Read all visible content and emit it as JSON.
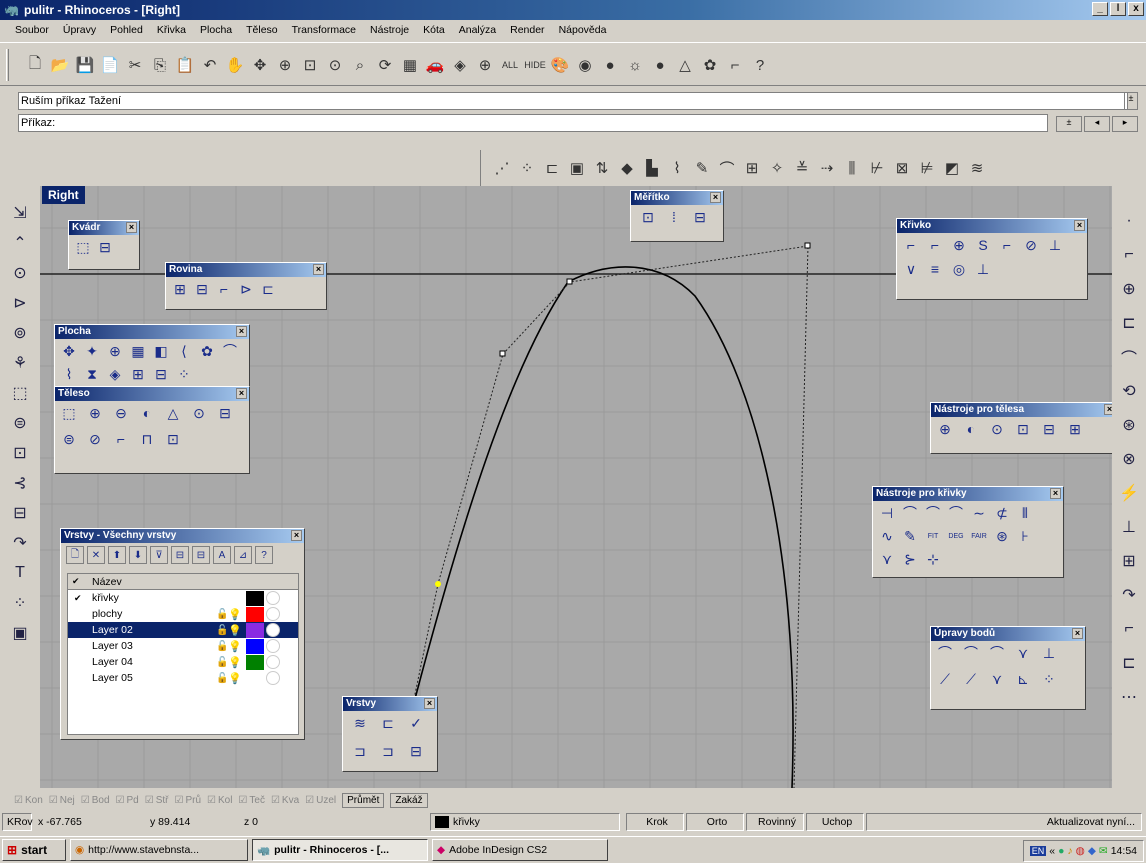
{
  "window": {
    "title": "pulitr - Rhinoceros - [Right]",
    "min": "_",
    "max": "ǀ",
    "close": "x"
  },
  "menu": [
    "Soubor",
    "Úpravy",
    "Pohled",
    "Křivka",
    "Plocha",
    "Těleso",
    "Transformace",
    "Nástroje",
    "Kóta",
    "Analýza",
    "Render",
    "Nápověda"
  ],
  "toolbar1": [
    "🗋",
    "📂",
    "💾",
    "📄",
    "✂",
    "⎘",
    "📋",
    "↶",
    "✋",
    "✥",
    "⊕",
    "⊡",
    "⊙",
    "⌕",
    "⟳",
    "▦",
    "🚗",
    "◈",
    "⊕",
    "ALL",
    "HIDE",
    "🎨",
    "◉",
    "●",
    "☼",
    "●",
    "△",
    "✿",
    "⌐",
    "?"
  ],
  "command": {
    "history": "Ruším příkaz Tažení",
    "prompt": "Příkaz:"
  },
  "toolbar2": [
    "⋰",
    "⁘",
    "⊏",
    "▣",
    "⇅",
    "◆",
    "▙",
    "⌇",
    "✎",
    "⌒",
    "⊞",
    "✧",
    "≚",
    "⇢",
    "⫼",
    "⊬",
    "⊠",
    "⊭",
    "◩",
    "≋"
  ],
  "viewport": {
    "name": "Right",
    "background": "#a9a9a9"
  },
  "left_tools": [
    "⇲",
    "⌃",
    "⊙",
    "⊳",
    "⊚",
    "⚘",
    "⬚",
    "⊜",
    "⊡",
    "⊰",
    "⊟",
    "↷",
    "T",
    "⁘",
    "▣"
  ],
  "right_tools": [
    "·",
    "⌐",
    "⊕",
    "⊏",
    "⌒",
    "⟲",
    "⊛",
    "⊗",
    "⚡",
    "⊥",
    "⊞",
    "↷",
    "⌐",
    "⊏",
    "⋯"
  ],
  "panels": {
    "kvadr": {
      "title": "Kvádr",
      "icons": [
        "⬚",
        "⊟"
      ]
    },
    "rovina": {
      "title": "Rovina",
      "icons": [
        "⊞",
        "⊟",
        "⌐",
        "⊳",
        "⊏"
      ]
    },
    "plocha": {
      "title": "Plocha",
      "icons": [
        "✥",
        "✦",
        "⊕",
        "▦",
        "◧",
        "⟨",
        "✿",
        "⌒",
        "⌇",
        "⧗",
        "◈",
        "⊞",
        "⊟",
        "⁘"
      ]
    },
    "teleso": {
      "title": "Těleso",
      "icons": [
        "⬚",
        "⊕",
        "⊖",
        "◐",
        "△",
        "⊙",
        "⊟",
        "⊜",
        "⊘",
        "⌐",
        "⊓",
        "⊡"
      ]
    },
    "meritko": {
      "title": "Měřítko",
      "icons": [
        "⊡",
        "⁞",
        "⊟"
      ]
    },
    "krivko": {
      "title": "Křivko",
      "icons": [
        "⌐",
        "⌐",
        "⊕",
        "S",
        "⌐",
        "⊘",
        "⊥",
        "∨",
        "≡",
        "◎",
        "⊥"
      ]
    },
    "nastroje_telesa": {
      "title": "Nástroje pro tělesa",
      "icons": [
        "⊕",
        "◐",
        "⊙",
        "⊡",
        "⊟",
        "⊞"
      ]
    },
    "nastroje_krivky": {
      "title": "Nástroje pro křivky",
      "icons": [
        "⊣",
        "⌒",
        "⌒",
        "⌒",
        "∼",
        "⊄",
        "⫴",
        "∿",
        "✎",
        "FIT",
        "DEG",
        "FAIR",
        "⊛",
        "⊦",
        "⋎",
        "⊱",
        "⊹"
      ]
    },
    "upravy_bodu": {
      "title": "Úpravy bodů",
      "icons": [
        "⌒",
        "⌒",
        "⌒",
        "⋎",
        "⊥",
        "⟋",
        "⟋",
        "⋎",
        "⊾",
        "⁘"
      ]
    },
    "vrstvy_small": {
      "title": "Vrstvy",
      "icons": [
        "≋",
        "⊏",
        "✓",
        "⊐",
        "⊐",
        "⊟"
      ]
    }
  },
  "layers": {
    "title": "Vrstvy - Všechny vrstvy",
    "toolbar": [
      "🗋",
      "✕",
      "⬆",
      "⬇",
      "⊽",
      "⊟",
      "⊟",
      "A",
      "⊿",
      "?"
    ],
    "header": "Název",
    "rows": [
      {
        "name": "křivky",
        "current": "✔",
        "lock": "",
        "bulb": "",
        "color": "#000000",
        "selected": false
      },
      {
        "name": "plochy",
        "current": "",
        "lock": "🔓",
        "bulb": "💡",
        "color": "#ff0000",
        "selected": false
      },
      {
        "name": "Layer 02",
        "current": "",
        "lock": "🔓",
        "bulb": "💡",
        "color": "#8a2be2",
        "selected": true
      },
      {
        "name": "Layer 03",
        "current": "",
        "lock": "🔓",
        "bulb": "💡",
        "color": "#0000ff",
        "selected": false
      },
      {
        "name": "Layer 04",
        "current": "",
        "lock": "🔓",
        "bulb": "💡",
        "color": "#008000",
        "selected": false
      },
      {
        "name": "Layer 05",
        "current": "",
        "lock": "🔓",
        "bulb": "💡",
        "color": "",
        "selected": false
      }
    ]
  },
  "osnap": [
    "Kon",
    "Nej",
    "Bod",
    "Pd",
    "Stř",
    "Prů",
    "Kol",
    "Teč",
    "Kva",
    "Uzel"
  ],
  "view_tabs": [
    "Průmět",
    "Zakáž"
  ],
  "status": {
    "x": "x -67.765",
    "y": "y 89.414",
    "z": "z 0",
    "cplane": "KRov",
    "layer": "křivky",
    "snap": "Krok",
    "ortho": "Orto",
    "planar": "Rovinný",
    "osnap": "Uchop",
    "update": "Aktualizovat nyní..."
  },
  "taskbar": {
    "start": "start",
    "items": [
      "http://www.stavebnsta...",
      "pulitr - Rhinoceros - [...",
      "Adobe InDesign CS2"
    ],
    "clock": "14:54",
    "tray": [
      "EN",
      "«"
    ]
  }
}
